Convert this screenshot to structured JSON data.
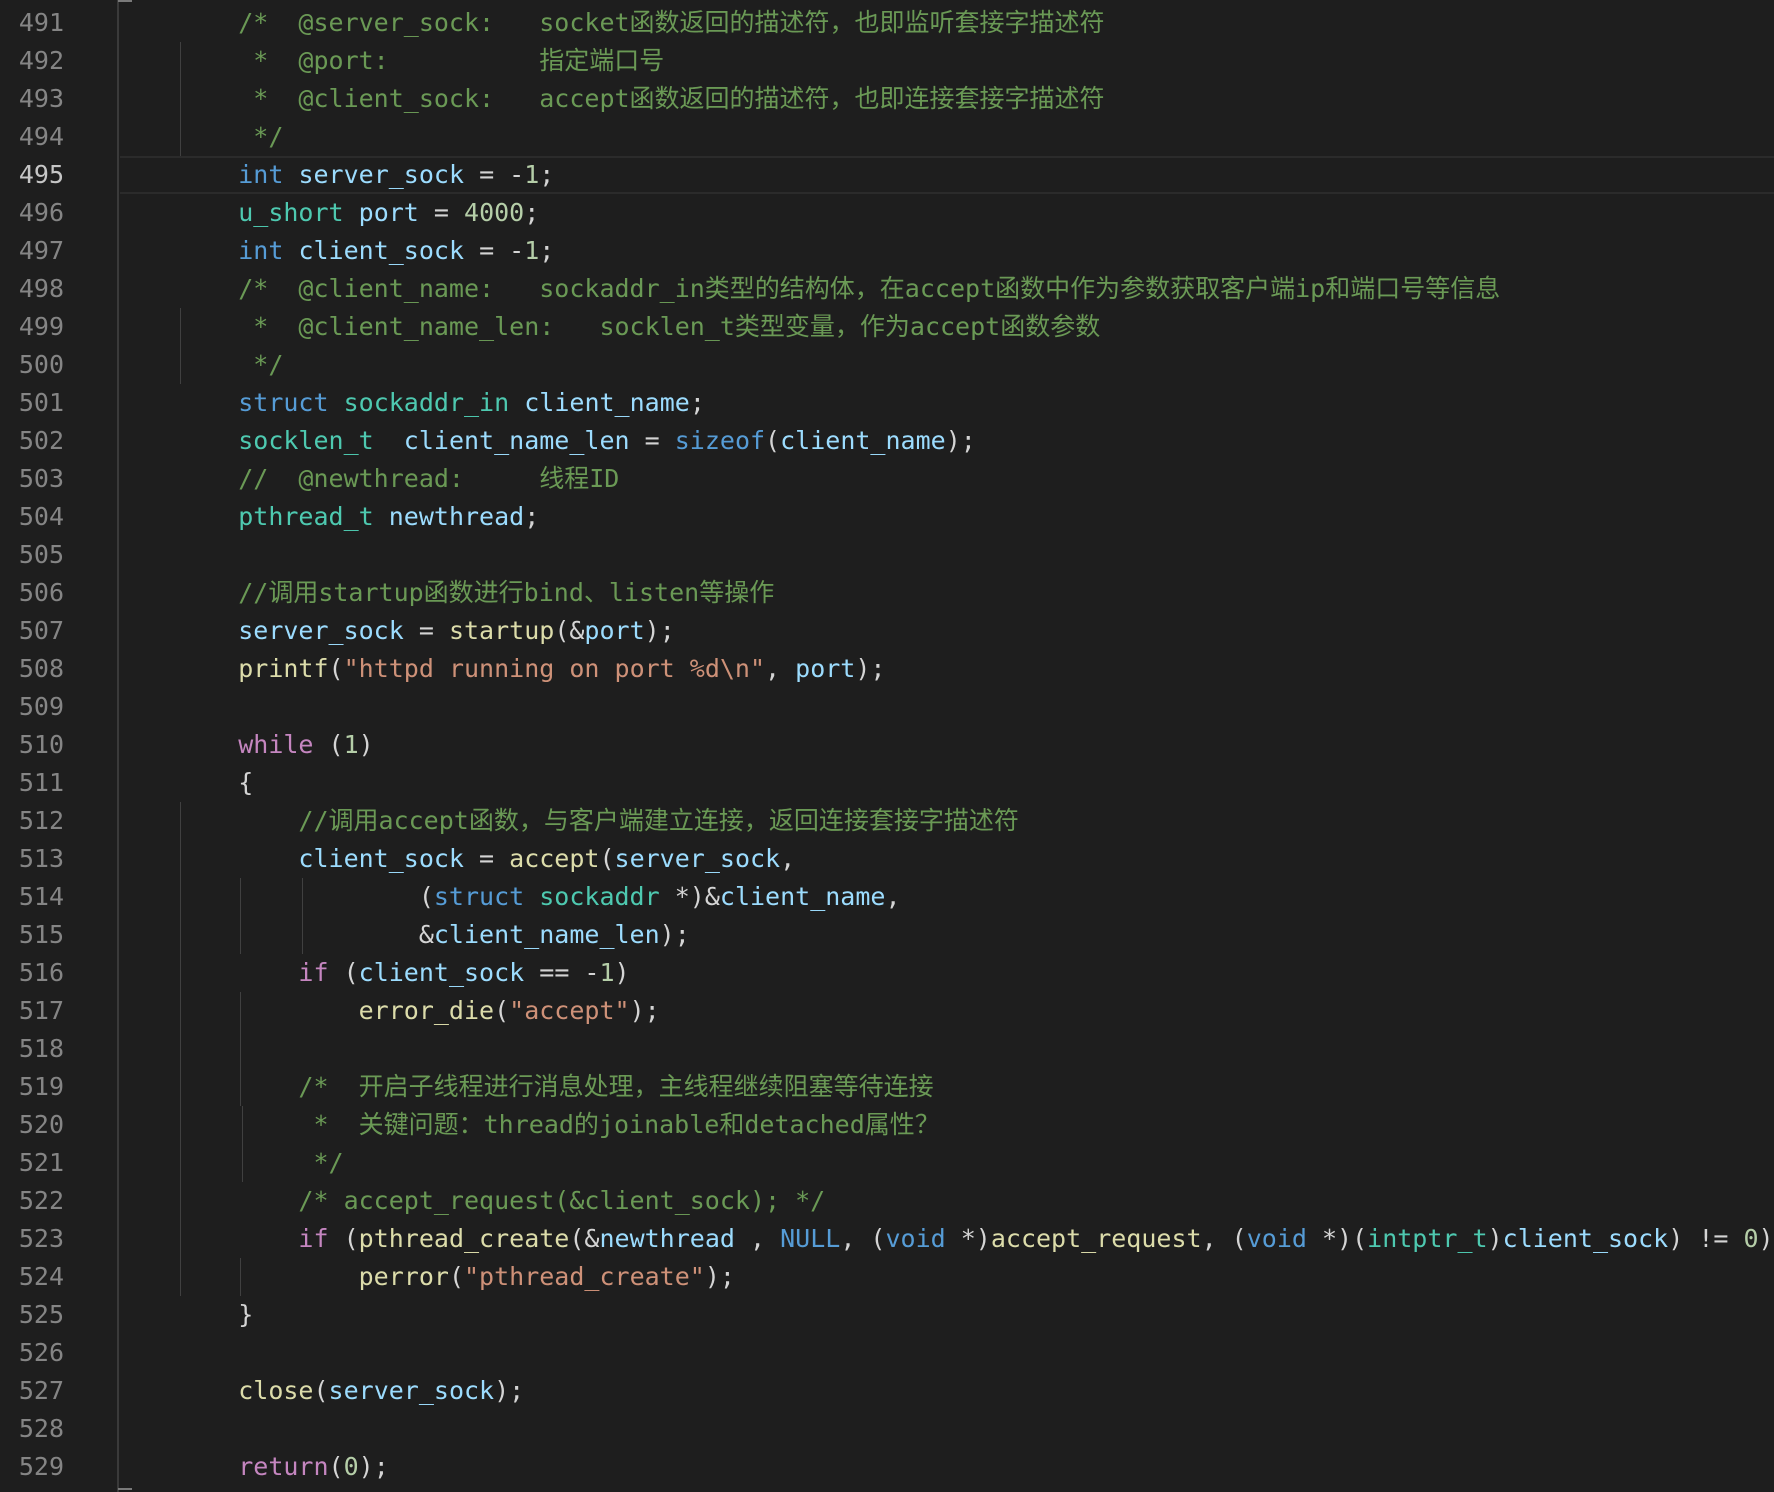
{
  "editor": {
    "current_line": 495,
    "colors": {
      "background": "#1e1e1e",
      "line_number": "#858585",
      "current_line_number": "#c6c6c6",
      "comment": "#6a9955",
      "keyword": "#569cd6",
      "control": "#c586c0",
      "type": "#4ec9b0",
      "variable": "#9cdcfe",
      "function": "#dcdcaa",
      "string": "#ce9178",
      "number": "#b5cea8",
      "text": "#d4d4d4"
    },
    "lines": [
      {
        "n": "491",
        "tokens": [
          {
            "t": "    ",
            "k": "punct"
          },
          {
            "t": "/*  @server_sock:   socket函数返回的描述符，也即监听套接字描述符",
            "k": "comment"
          }
        ]
      },
      {
        "n": "492",
        "tokens": [
          {
            "t": "     ",
            "k": "punct"
          },
          {
            "t": "*  @port:          指定端口号",
            "k": "comment"
          }
        ]
      },
      {
        "n": "493",
        "tokens": [
          {
            "t": "     ",
            "k": "punct"
          },
          {
            "t": "*  @client_sock:   accept函数返回的描述符，也即连接套接字描述符",
            "k": "comment"
          }
        ]
      },
      {
        "n": "494",
        "tokens": [
          {
            "t": "     ",
            "k": "punct"
          },
          {
            "t": "*/",
            "k": "comment"
          }
        ]
      },
      {
        "n": "495",
        "tokens": [
          {
            "t": "    ",
            "k": "punct"
          },
          {
            "t": "int",
            "k": "keyword"
          },
          {
            "t": " ",
            "k": "punct"
          },
          {
            "t": "server_sock",
            "k": "var"
          },
          {
            "t": " = -",
            "k": "punct"
          },
          {
            "t": "1",
            "k": "number"
          },
          {
            "t": ";",
            "k": "punct"
          }
        ]
      },
      {
        "n": "496",
        "tokens": [
          {
            "t": "    ",
            "k": "punct"
          },
          {
            "t": "u_short",
            "k": "type"
          },
          {
            "t": " ",
            "k": "punct"
          },
          {
            "t": "port",
            "k": "var"
          },
          {
            "t": " = ",
            "k": "punct"
          },
          {
            "t": "4000",
            "k": "number"
          },
          {
            "t": ";",
            "k": "punct"
          }
        ]
      },
      {
        "n": "497",
        "tokens": [
          {
            "t": "    ",
            "k": "punct"
          },
          {
            "t": "int",
            "k": "keyword"
          },
          {
            "t": " ",
            "k": "punct"
          },
          {
            "t": "client_sock",
            "k": "var"
          },
          {
            "t": " = -",
            "k": "punct"
          },
          {
            "t": "1",
            "k": "number"
          },
          {
            "t": ";",
            "k": "punct"
          }
        ]
      },
      {
        "n": "498",
        "tokens": [
          {
            "t": "    ",
            "k": "punct"
          },
          {
            "t": "/*  @client_name:   sockaddr_in类型的结构体，在accept函数中作为参数获取客户端ip和端口号等信息",
            "k": "comment"
          }
        ]
      },
      {
        "n": "499",
        "tokens": [
          {
            "t": "     ",
            "k": "punct"
          },
          {
            "t": "*  @client_name_len:   socklen_t类型变量，作为accept函数参数",
            "k": "comment"
          }
        ]
      },
      {
        "n": "500",
        "tokens": [
          {
            "t": "     ",
            "k": "punct"
          },
          {
            "t": "*/",
            "k": "comment"
          }
        ]
      },
      {
        "n": "501",
        "tokens": [
          {
            "t": "    ",
            "k": "punct"
          },
          {
            "t": "struct",
            "k": "keyword"
          },
          {
            "t": " ",
            "k": "punct"
          },
          {
            "t": "sockaddr_in",
            "k": "type"
          },
          {
            "t": " ",
            "k": "punct"
          },
          {
            "t": "client_name",
            "k": "var"
          },
          {
            "t": ";",
            "k": "punct"
          }
        ]
      },
      {
        "n": "502",
        "tokens": [
          {
            "t": "    ",
            "k": "punct"
          },
          {
            "t": "socklen_t",
            "k": "type"
          },
          {
            "t": "  ",
            "k": "punct"
          },
          {
            "t": "client_name_len",
            "k": "var"
          },
          {
            "t": " = ",
            "k": "punct"
          },
          {
            "t": "sizeof",
            "k": "keyword"
          },
          {
            "t": "(",
            "k": "punct"
          },
          {
            "t": "client_name",
            "k": "var"
          },
          {
            "t": ");",
            "k": "punct"
          }
        ]
      },
      {
        "n": "503",
        "tokens": [
          {
            "t": "    ",
            "k": "punct"
          },
          {
            "t": "//  @newthread:     线程ID",
            "k": "comment"
          }
        ]
      },
      {
        "n": "504",
        "tokens": [
          {
            "t": "    ",
            "k": "punct"
          },
          {
            "t": "pthread_t",
            "k": "type"
          },
          {
            "t": " ",
            "k": "punct"
          },
          {
            "t": "newthread",
            "k": "var"
          },
          {
            "t": ";",
            "k": "punct"
          }
        ]
      },
      {
        "n": "505",
        "tokens": []
      },
      {
        "n": "506",
        "tokens": [
          {
            "t": "    ",
            "k": "punct"
          },
          {
            "t": "//调用startup函数进行bind、listen等操作",
            "k": "comment"
          }
        ]
      },
      {
        "n": "507",
        "tokens": [
          {
            "t": "    ",
            "k": "punct"
          },
          {
            "t": "server_sock",
            "k": "var"
          },
          {
            "t": " = ",
            "k": "punct"
          },
          {
            "t": "startup",
            "k": "func"
          },
          {
            "t": "(&",
            "k": "punct"
          },
          {
            "t": "port",
            "k": "var"
          },
          {
            "t": ");",
            "k": "punct"
          }
        ]
      },
      {
        "n": "508",
        "tokens": [
          {
            "t": "    ",
            "k": "punct"
          },
          {
            "t": "printf",
            "k": "func"
          },
          {
            "t": "(",
            "k": "punct"
          },
          {
            "t": "\"httpd running on port %d\\n\"",
            "k": "string"
          },
          {
            "t": ", ",
            "k": "punct"
          },
          {
            "t": "port",
            "k": "var"
          },
          {
            "t": ");",
            "k": "punct"
          }
        ]
      },
      {
        "n": "509",
        "tokens": []
      },
      {
        "n": "510",
        "tokens": [
          {
            "t": "    ",
            "k": "punct"
          },
          {
            "t": "while",
            "k": "control"
          },
          {
            "t": " (",
            "k": "punct"
          },
          {
            "t": "1",
            "k": "number"
          },
          {
            "t": ")",
            "k": "punct"
          }
        ]
      },
      {
        "n": "511",
        "tokens": [
          {
            "t": "    {",
            "k": "punct"
          }
        ]
      },
      {
        "n": "512",
        "tokens": [
          {
            "t": "        ",
            "k": "punct"
          },
          {
            "t": "//调用accept函数，与客户端建立连接，返回连接套接字描述符",
            "k": "comment"
          }
        ]
      },
      {
        "n": "513",
        "tokens": [
          {
            "t": "        ",
            "k": "punct"
          },
          {
            "t": "client_sock",
            "k": "var"
          },
          {
            "t": " = ",
            "k": "punct"
          },
          {
            "t": "accept",
            "k": "func"
          },
          {
            "t": "(",
            "k": "punct"
          },
          {
            "t": "server_sock",
            "k": "var"
          },
          {
            "t": ",",
            "k": "punct"
          }
        ]
      },
      {
        "n": "514",
        "tokens": [
          {
            "t": "                (",
            "k": "punct"
          },
          {
            "t": "struct",
            "k": "keyword"
          },
          {
            "t": " ",
            "k": "punct"
          },
          {
            "t": "sockaddr",
            "k": "type"
          },
          {
            "t": " *)&",
            "k": "punct"
          },
          {
            "t": "client_name",
            "k": "var"
          },
          {
            "t": ",",
            "k": "punct"
          }
        ]
      },
      {
        "n": "515",
        "tokens": [
          {
            "t": "                &",
            "k": "punct"
          },
          {
            "t": "client_name_len",
            "k": "var"
          },
          {
            "t": ");",
            "k": "punct"
          }
        ]
      },
      {
        "n": "516",
        "tokens": [
          {
            "t": "        ",
            "k": "punct"
          },
          {
            "t": "if",
            "k": "control"
          },
          {
            "t": " (",
            "k": "punct"
          },
          {
            "t": "client_sock",
            "k": "var"
          },
          {
            "t": " == -",
            "k": "punct"
          },
          {
            "t": "1",
            "k": "number"
          },
          {
            "t": ")",
            "k": "punct"
          }
        ]
      },
      {
        "n": "517",
        "tokens": [
          {
            "t": "            ",
            "k": "punct"
          },
          {
            "t": "error_die",
            "k": "func"
          },
          {
            "t": "(",
            "k": "punct"
          },
          {
            "t": "\"accept\"",
            "k": "string"
          },
          {
            "t": ");",
            "k": "punct"
          }
        ]
      },
      {
        "n": "518",
        "tokens": []
      },
      {
        "n": "519",
        "tokens": [
          {
            "t": "        ",
            "k": "punct"
          },
          {
            "t": "/*  开启子线程进行消息处理，主线程继续阻塞等待连接",
            "k": "comment"
          }
        ]
      },
      {
        "n": "520",
        "tokens": [
          {
            "t": "         ",
            "k": "punct"
          },
          {
            "t": "*  关键问题：thread的joinable和detached属性？",
            "k": "comment"
          }
        ]
      },
      {
        "n": "521",
        "tokens": [
          {
            "t": "         ",
            "k": "punct"
          },
          {
            "t": "*/",
            "k": "comment"
          }
        ]
      },
      {
        "n": "522",
        "tokens": [
          {
            "t": "        ",
            "k": "punct"
          },
          {
            "t": "/* accept_request(&client_sock); */",
            "k": "comment"
          }
        ]
      },
      {
        "n": "523",
        "tokens": [
          {
            "t": "        ",
            "k": "punct"
          },
          {
            "t": "if",
            "k": "control"
          },
          {
            "t": " (",
            "k": "punct"
          },
          {
            "t": "pthread_create",
            "k": "func"
          },
          {
            "t": "(&",
            "k": "punct"
          },
          {
            "t": "newthread",
            "k": "var"
          },
          {
            "t": " , ",
            "k": "punct"
          },
          {
            "t": "NULL",
            "k": "keyword"
          },
          {
            "t": ", (",
            "k": "punct"
          },
          {
            "t": "void",
            "k": "keyword"
          },
          {
            "t": " *)",
            "k": "punct"
          },
          {
            "t": "accept_request",
            "k": "func"
          },
          {
            "t": ", (",
            "k": "punct"
          },
          {
            "t": "void",
            "k": "keyword"
          },
          {
            "t": " *)(",
            "k": "punct"
          },
          {
            "t": "intptr_t",
            "k": "type"
          },
          {
            "t": ")",
            "k": "punct"
          },
          {
            "t": "client_sock",
            "k": "var"
          },
          {
            "t": ") != ",
            "k": "punct"
          },
          {
            "t": "0",
            "k": "number"
          },
          {
            "t": ")",
            "k": "punct"
          }
        ]
      },
      {
        "n": "524",
        "tokens": [
          {
            "t": "            ",
            "k": "punct"
          },
          {
            "t": "perror",
            "k": "func"
          },
          {
            "t": "(",
            "k": "punct"
          },
          {
            "t": "\"pthread_create\"",
            "k": "string"
          },
          {
            "t": ");",
            "k": "punct"
          }
        ]
      },
      {
        "n": "525",
        "tokens": [
          {
            "t": "    }",
            "k": "punct"
          }
        ]
      },
      {
        "n": "526",
        "tokens": []
      },
      {
        "n": "527",
        "tokens": [
          {
            "t": "    ",
            "k": "punct"
          },
          {
            "t": "close",
            "k": "func"
          },
          {
            "t": "(",
            "k": "punct"
          },
          {
            "t": "server_sock",
            "k": "var"
          },
          {
            "t": ");",
            "k": "punct"
          }
        ]
      },
      {
        "n": "528",
        "tokens": []
      },
      {
        "n": "529",
        "tokens": [
          {
            "t": "    ",
            "k": "punct"
          },
          {
            "t": "return",
            "k": "control"
          },
          {
            "t": "(",
            "k": "punct"
          },
          {
            "t": "0",
            "k": "number"
          },
          {
            "t": ");",
            "k": "punct"
          }
        ]
      }
    ]
  }
}
